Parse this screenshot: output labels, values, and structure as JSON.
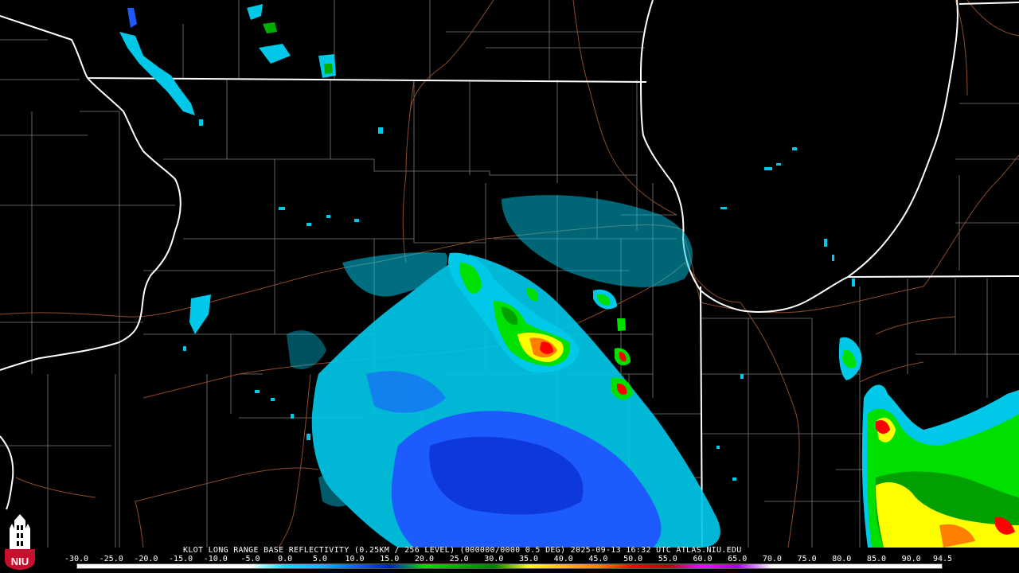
{
  "product": {
    "title": "KLOT LONG RANGE BASE REFLECTIVITY (0.25KM / 256 LEVEL) (000000/0000 0.5 DEG) 2025-09-13 16:32 UTC  ATLAS.NIU.EDU"
  },
  "legend": {
    "tick_labels": [
      "-30.0",
      "-25.0",
      "-20.0",
      "-15.0",
      "-10.0",
      "-5.0",
      "0.0",
      "5.0",
      "10.0",
      "15.0",
      "20.0",
      "25.0",
      "30.0",
      "35.0",
      "40.0",
      "45.0",
      "50.0",
      "55.0",
      "60.0",
      "65.0",
      "70.0",
      "75.0",
      "80.0",
      "85.0",
      "90.0",
      "94.5"
    ],
    "min_value": -30.0,
    "max_value": 94.5,
    "color_stops": [
      {
        "value": -30,
        "color": "#ffffff"
      },
      {
        "value": -5,
        "color": "#ffffff"
      },
      {
        "value": 0,
        "color": "#00e5ee"
      },
      {
        "value": 5,
        "color": "#00bfff"
      },
      {
        "value": 10,
        "color": "#1e5bff"
      },
      {
        "value": 15,
        "color": "#0020c0"
      },
      {
        "value": 20,
        "color": "#00e000"
      },
      {
        "value": 25,
        "color": "#00b000"
      },
      {
        "value": 30,
        "color": "#008000"
      },
      {
        "value": 35,
        "color": "#ffff00"
      },
      {
        "value": 40,
        "color": "#ffc000"
      },
      {
        "value": 45,
        "color": "#ff8000"
      },
      {
        "value": 50,
        "color": "#ff0000"
      },
      {
        "value": 55,
        "color": "#c00000"
      },
      {
        "value": 60,
        "color": "#ff00ff"
      },
      {
        "value": 65,
        "color": "#a000ff"
      },
      {
        "value": 70,
        "color": "#ffffff"
      },
      {
        "value": 94.5,
        "color": "#ffffff"
      }
    ]
  },
  "logo": {
    "text": "NIU",
    "color": "#c8102e"
  },
  "colors": {
    "state_border": "#ffffff",
    "county_line": "#8a8a8a",
    "highway": "#8b4a2a",
    "background": "#000000"
  }
}
